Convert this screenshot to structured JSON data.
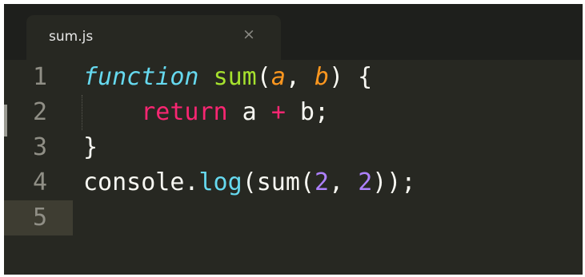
{
  "tab": {
    "title": "sum.js",
    "close_glyph": "×"
  },
  "colors": {
    "background": "#272822",
    "storage": "#66d9ef",
    "function_name": "#a6e22e",
    "parameter": "#fd971f",
    "keyword": "#f92672",
    "number": "#ae81ff",
    "text": "#f8f8f2"
  },
  "lines": [
    {
      "number": "1",
      "tokens": [
        {
          "t": "function",
          "c": "k-storage"
        },
        {
          "t": " ",
          "c": "k-plain"
        },
        {
          "t": "sum",
          "c": "k-fn"
        },
        {
          "t": "(",
          "c": "k-plain"
        },
        {
          "t": "a",
          "c": "k-param"
        },
        {
          "t": ", ",
          "c": "k-plain"
        },
        {
          "t": "b",
          "c": "k-param"
        },
        {
          "t": ") {",
          "c": "k-plain"
        }
      ]
    },
    {
      "number": "2",
      "tokens": [
        {
          "t": "    ",
          "c": "k-plain"
        },
        {
          "t": "return",
          "c": "k-keyword"
        },
        {
          "t": " a ",
          "c": "k-plain"
        },
        {
          "t": "+",
          "c": "k-op"
        },
        {
          "t": " b;",
          "c": "k-plain"
        }
      ]
    },
    {
      "number": "3",
      "tokens": [
        {
          "t": "}",
          "c": "k-plain"
        }
      ]
    },
    {
      "number": "4",
      "tokens": [
        {
          "t": "console.",
          "c": "k-plain"
        },
        {
          "t": "log",
          "c": "k-support"
        },
        {
          "t": "(sum(",
          "c": "k-plain"
        },
        {
          "t": "2",
          "c": "k-num"
        },
        {
          "t": ", ",
          "c": "k-plain"
        },
        {
          "t": "2",
          "c": "k-num"
        },
        {
          "t": "));",
          "c": "k-plain"
        }
      ]
    },
    {
      "number": "5",
      "tokens": []
    }
  ]
}
